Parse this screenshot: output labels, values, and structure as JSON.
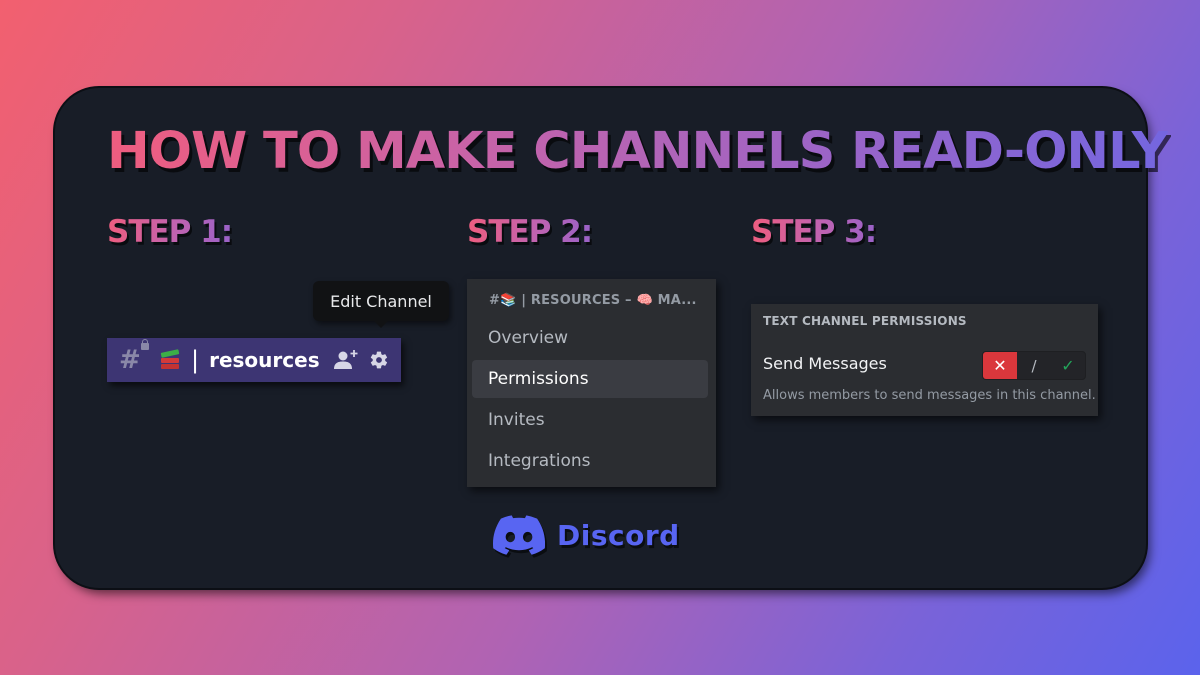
{
  "title": "HOW TO MAKE CHANNELS READ-ONLY",
  "steps": [
    {
      "label": "STEP 1:"
    },
    {
      "label": "STEP 2:"
    },
    {
      "label": "STEP 3:"
    }
  ],
  "step1": {
    "tooltip": "Edit Channel",
    "channel": {
      "type_icon": "locked-hash-icon",
      "emoji": "books-emoji",
      "separator": "|",
      "name": "resources",
      "actions": [
        {
          "icon": "add-member-icon"
        },
        {
          "icon": "gear-icon"
        }
      ]
    }
  },
  "step2": {
    "header": "#📚 | RESOURCES – 🧠 MA...",
    "items": [
      {
        "label": "Overview",
        "active": false
      },
      {
        "label": "Permissions",
        "active": true
      },
      {
        "label": "Invites",
        "active": false
      },
      {
        "label": "Integrations",
        "active": false
      }
    ]
  },
  "step3": {
    "section_title": "TEXT CHANNEL PERMISSIONS",
    "permission": {
      "name": "Send Messages",
      "description": "Allows members to send messages in this channel.",
      "state": "deny",
      "toggle": {
        "deny": "✕",
        "neutral": "/",
        "allow": "✓"
      }
    }
  },
  "brand": {
    "name": "Discord",
    "color": "#5865f2"
  },
  "colors": {
    "deny": "#da373c",
    "allow": "#23a55a",
    "channel_bar": "#3d3573",
    "panel": "#2b2d31",
    "card": "#181d27"
  }
}
